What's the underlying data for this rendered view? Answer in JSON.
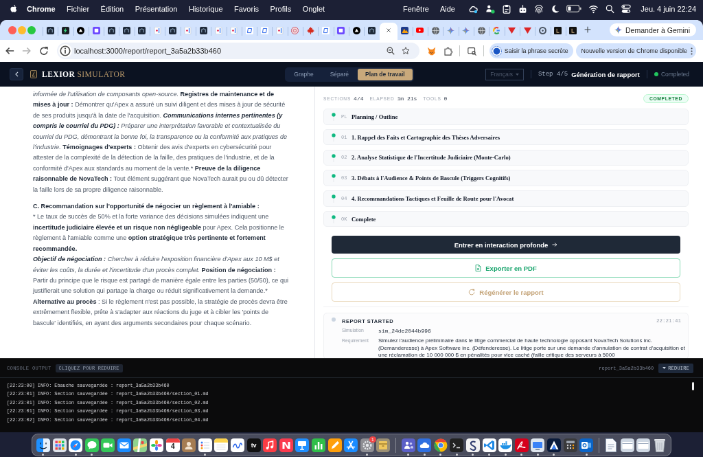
{
  "menu_bar": {
    "app_name": "Chrome",
    "menus": [
      "Fichier",
      "Édition",
      "Présentation",
      "Historique",
      "Favoris",
      "Profils",
      "Onglet"
    ],
    "more_menus": [
      "Fenêtre",
      "Aide"
    ],
    "clock": "Jeu. 4 juin 22:24"
  },
  "browser": {
    "tabs": [
      {
        "kind": "app",
        "selected": false
      },
      {
        "kind": "bolt",
        "selected": false
      },
      {
        "kind": "triangle",
        "selected": false
      },
      {
        "kind": "square",
        "selected": false
      },
      {
        "kind": "app",
        "selected": false
      },
      {
        "kind": "app",
        "selected": false
      },
      {
        "kind": "app",
        "selected": false
      },
      {
        "kind": "flag",
        "selected": false
      },
      {
        "kind": "app",
        "selected": false
      },
      {
        "kind": "flag",
        "selected": false
      },
      {
        "kind": "app",
        "selected": false
      },
      {
        "kind": "flag",
        "selected": false
      },
      {
        "kind": "flag",
        "selected": false
      },
      {
        "kind": "page",
        "selected": false
      },
      {
        "kind": "page",
        "selected": false
      },
      {
        "kind": "flag",
        "selected": false
      },
      {
        "kind": "seal",
        "selected": false
      },
      {
        "kind": "leaf",
        "selected": false
      },
      {
        "kind": "page",
        "selected": false
      },
      {
        "kind": "square",
        "selected": false
      },
      {
        "kind": "triangle",
        "selected": false
      },
      {
        "kind": "app",
        "selected": false
      },
      {
        "selected": true
      },
      {
        "kind": "gradient",
        "selected": false
      },
      {
        "kind": "play",
        "selected": false
      },
      {
        "kind": "globe",
        "selected": false
      },
      {
        "kind": "sparkle",
        "selected": false
      },
      {
        "kind": "sparkle",
        "selected": false
      },
      {
        "kind": "globe",
        "selected": false
      },
      {
        "kind": "g",
        "selected": false
      },
      {
        "kind": "down",
        "selected": false
      },
      {
        "kind": "down",
        "selected": false
      },
      {
        "kind": "circle",
        "selected": false
      },
      {
        "kind": "ltile",
        "selected": false
      },
      {
        "kind": "ltile",
        "selected": false
      }
    ],
    "gemini_button": "Demander à Gemini",
    "url": "localhost:3000/report/report_3a5a2b33b460",
    "chips": [
      {
        "label": "Saisir la phrase secrète",
        "kind": "account"
      },
      {
        "label": "Nouvelle version de Chrome disponible",
        "kind": "update"
      }
    ]
  },
  "header": {
    "brand_name": "LEXIOR",
    "brand_suffix": "SIMULATOR",
    "views": [
      {
        "label": "Graphe",
        "selected": false
      },
      {
        "label": "Séparé",
        "selected": false
      },
      {
        "label": "Plan de travail",
        "selected": true
      }
    ],
    "language": {
      "value": "Français",
      "disabled": true
    },
    "step": {
      "counter": "Step 4/5",
      "title": "Génération de rapport"
    },
    "status": {
      "label": "Completed",
      "complete": true
    }
  },
  "report": {
    "blocks": [
      {
        "kind": "paragraph",
        "runs": [
          {
            "text": "informée de l'utilisation de composants open-source. ",
            "bold": false,
            "italic": true
          },
          {
            "text": "Registres de maintenance et de mises à jour :",
            "bold": true,
            "italic": false
          },
          {
            "text": " Démontrer qu'Apex a assuré un suivi diligent et des mises à jour de sécurité de ses produits jusqu'à la date de l'acquisition. ",
            "bold": false,
            "italic": false
          },
          {
            "text": "Communications internes pertinentes (y compris le courriel du PDG) :",
            "bold": true,
            "italic": true
          },
          {
            "text": " Préparer une interprétation favorable et contextualisée du courriel du PDG, démontrant la bonne foi, la transparence ou la conformité aux pratiques de l'industrie. ",
            "bold": false,
            "italic": true
          },
          {
            "text": "Témoignages d'experts :",
            "bold": true,
            "italic": false
          },
          {
            "text": " Obtenir des avis d'experts en cybersécurité pour attester de la complexité de la détection de la faille, des pratiques de l'industrie, et de la conformité d'Apex aux standards au moment de la vente.* ",
            "bold": false,
            "italic": false
          },
          {
            "text": "Preuve de la diligence raisonnable de NovaTech :",
            "bold": true,
            "italic": false
          },
          {
            "text": " Tout élément suggérant que NovaTech aurait pu ou dû détecter la faille lors de sa propre diligence raisonnable.",
            "bold": false,
            "italic": false
          }
        ]
      },
      {
        "kind": "heading",
        "text": "C. Recommandation sur l'opportunité de négocier un règlement à l'amiable :"
      },
      {
        "kind": "paragraph",
        "runs": [
          {
            "text": "* Le taux de succès de 50% et la forte variance des décisions simulées indiquent une ",
            "bold": false,
            "italic": false
          },
          {
            "text": "incertitude judiciaire élevée et un risque non négligeable",
            "bold": true,
            "italic": false
          },
          {
            "text": " pour Apex. Cela positionne le règlement à l'amiable comme une ",
            "bold": false,
            "italic": false
          },
          {
            "text": "option stratégique très pertinente et fortement recommandée.",
            "bold": true,
            "italic": false
          }
        ]
      },
      {
        "kind": "paragraph",
        "runs": [
          {
            "text": "Objectif de négociation :",
            "bold": true,
            "italic": true
          },
          {
            "text": " Chercher à réduire l'exposition financière d'Apex aux 10 M$ et éviter les coûts, la durée et l'incertitude d'un procès complet. ",
            "bold": false,
            "italic": true
          },
          {
            "text": "Position de négociation :",
            "bold": true,
            "italic": false
          },
          {
            "text": " Partir du principe que le risque est partagé de manière égale entre les parties (50/50), ce qui justifierait une solution qui partage la charge ou réduit significativement la demande.* ",
            "bold": false,
            "italic": false
          },
          {
            "text": "Alternative au procès",
            "bold": true,
            "italic": false
          },
          {
            "text": " : Si le règlement n'est pas possible, la stratégie de procès devra être extrêmement flexible, prête à s'adapter aux réactions du juge et à cibler les 'points de bascule' identifiés, en ayant des arguments secondaires pour chaque scénario.",
            "bold": false,
            "italic": false
          }
        ]
      }
    ]
  },
  "progress": {
    "stats": [
      {
        "label": "SECTIONS",
        "value": "4/4"
      },
      {
        "label": "ELAPSED",
        "value": "1m 21s"
      },
      {
        "label": "TOOLS",
        "value": "0"
      }
    ],
    "badge": "COMPLETED",
    "sections": [
      {
        "code": "PL",
        "title": "Planning / Outline",
        "done": true
      },
      {
        "code": "01",
        "title": "1. Rappel des Faits et Cartographie des Thèses Adversaires",
        "done": true
      },
      {
        "code": "02",
        "title": "2. Analyse Statistique de l'Incertitude Judiciaire (Monte-Carlo)",
        "done": true
      },
      {
        "code": "03",
        "title": "3. Débats à l'Audience & Points de Bascule (Triggers Cognitifs)",
        "done": true
      },
      {
        "code": "04",
        "title": "4. Recommandations Tactiques et Feuille de Route pour l'Avocat",
        "done": true
      },
      {
        "code": "OK",
        "title": "Complete",
        "done": true
      }
    ],
    "actions": [
      {
        "label": "Entrer en interaction profonde",
        "kind": "primary"
      },
      {
        "label": "Exporter en PDF",
        "kind": "export"
      },
      {
        "label": "Régénérer le rapport",
        "kind": "regenerate"
      }
    ],
    "events": [
      {
        "title": "REPORT STARTED",
        "time": "22:21:41",
        "fields": [
          {
            "label": "Simulation",
            "value": "sim_24de2044b996",
            "kind": "code"
          },
          {
            "label": "Requirement",
            "value": "Simulez l'audience préliminaire dans le litige commercial de haute technologie opposant NovaTech Solutions inc. (Demanderesse) à Apex Software inc. (Défenderesse). Le litige porte sur une demande d'annulation de contrat d'acquisition et une réclamation de 10 000 000 $ en pénalités pour vice caché (faille critique des serveurs à 5000",
            "kind": "text"
          }
        ]
      }
    ]
  },
  "console": {
    "title": "CONSOLE OUTPUT",
    "hint": "CLIQUEZ POUR RÉDUIRE",
    "report_id": "report_3a5a2b33b460",
    "collapse_button": "RÉDUIRE",
    "lines": [
      "[22:23:00] INFO: Ébauche sauvegardée : report_3a5a2b33b460",
      "[22:23:01] INFO: Section sauvegardée : report_3a5a2b33b460/section_01.md",
      "[22:23:01] INFO: Section sauvegardée : report_3a5a2b33b460/section_02.md",
      "[22:23:01] INFO: Section sauvegardée : report_3a5a2b33b460/section_03.md",
      "[22:23:02] INFO: Section sauvegardée : report_3a5a2b33b460/section_04.md"
    ]
  },
  "dock": {
    "sections": [
      {
        "items": [
          {
            "kind": "finder",
            "running": true
          },
          {
            "kind": "launchpad",
            "running": false
          },
          {
            "kind": "safari",
            "running": true
          },
          {
            "kind": "messages",
            "running": true
          },
          {
            "kind": "facetime",
            "running": false
          },
          {
            "kind": "mail",
            "running": false
          },
          {
            "kind": "maps",
            "running": false
          },
          {
            "kind": "photos",
            "running": false
          },
          {
            "kind": "calendar",
            "running": false,
            "label": "4"
          },
          {
            "kind": "contacts",
            "running": false
          },
          {
            "kind": "reminders",
            "running": true
          },
          {
            "kind": "notes",
            "running": false
          },
          {
            "kind": "freeform",
            "running": false
          },
          {
            "kind": "tv",
            "running": false,
            "label": "tv"
          },
          {
            "kind": "music",
            "running": false
          },
          {
            "kind": "news",
            "running": false
          },
          {
            "kind": "keynote",
            "running": false
          },
          {
            "kind": "numbers",
            "running": false
          },
          {
            "kind": "pages",
            "running": false
          },
          {
            "kind": "appstore",
            "running": false
          },
          {
            "kind": "settings",
            "running": true,
            "badge": "1"
          },
          {
            "kind": "archive",
            "running": false
          }
        ]
      },
      {
        "items": [
          {
            "kind": "teams",
            "running": true
          },
          {
            "kind": "cloudapp",
            "running": true
          },
          {
            "kind": "chrome",
            "running": true
          },
          {
            "kind": "terminal",
            "running": true
          },
          {
            "kind": "writer",
            "running": true
          },
          {
            "kind": "vscode",
            "running": true
          },
          {
            "kind": "docker",
            "running": true
          },
          {
            "kind": "acrobat",
            "running": true
          },
          {
            "kind": "screens",
            "running": true
          },
          {
            "kind": "peak",
            "running": true
          },
          {
            "kind": "calculator",
            "running": false
          },
          {
            "kind": "outlook",
            "running": true
          }
        ]
      },
      {
        "items": [
          {
            "kind": "file",
            "running": false
          },
          {
            "kind": "window",
            "running": false
          },
          {
            "kind": "window",
            "running": false
          },
          {
            "kind": "trash",
            "running": false
          }
        ]
      }
    ]
  }
}
